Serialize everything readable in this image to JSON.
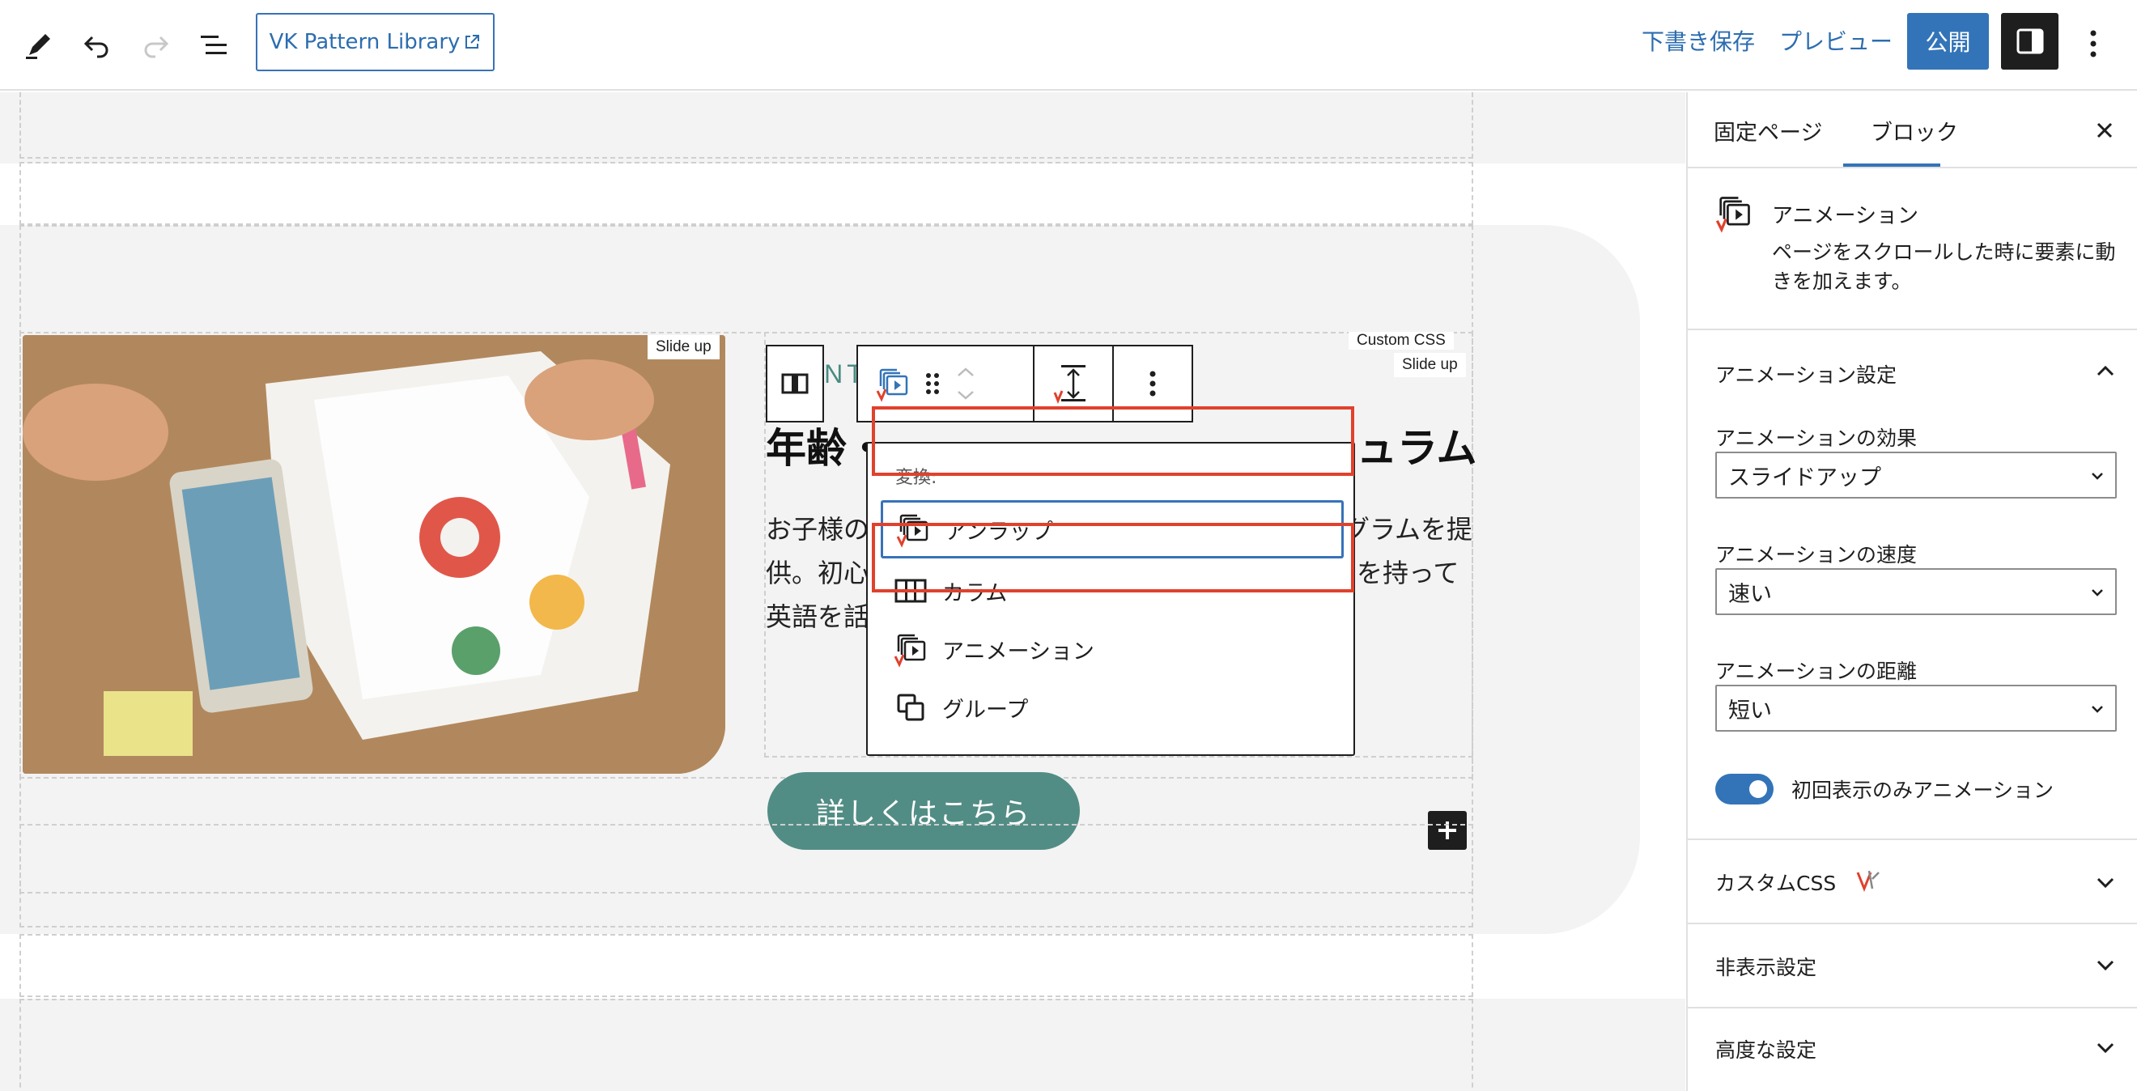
{
  "toolbar": {
    "pattern_library_label": "VK Pattern Library",
    "save_draft": "下書き保存",
    "preview": "プレビュー",
    "publish": "公開"
  },
  "canvas": {
    "badge_slide_up_image": "Slide up",
    "badge_custom_css": "Custom CSS",
    "badge_slide_up_text": "Slide up",
    "point_label": "POINT",
    "heading_left": "年齢・",
    "heading_right": "ュラム",
    "body_line1_left": "お子様の",
    "body_line1_right": "グラムを提",
    "body_line2_left": "供。初心",
    "body_line2_right": "を持って",
    "body_line3_left": "英語を話",
    "cta_label": "詳しくはこちら"
  },
  "transform_menu": {
    "label": "変換:",
    "items": [
      {
        "label": "アンラップ",
        "icon": "vk-animation-icon",
        "focused": true,
        "highlighted": true
      },
      {
        "label": "カラム",
        "icon": "columns-icon",
        "focused": false,
        "highlighted": false
      },
      {
        "label": "アニメーション",
        "icon": "vk-animation-icon",
        "focused": false,
        "highlighted": true
      },
      {
        "label": "グループ",
        "icon": "group-icon",
        "focused": false,
        "highlighted": false
      }
    ]
  },
  "sidebar": {
    "tabs": [
      "固定ページ",
      "ブロック"
    ],
    "active_tab": "ブロック",
    "block_title": "アニメーション",
    "block_desc": "ページをスクロールした時に要素に動きを加えます。",
    "animation_settings": {
      "title": "アニメーション設定",
      "effect_label": "アニメーションの効果",
      "effect_value": "スライドアップ",
      "speed_label": "アニメーションの速度",
      "speed_value": "速い",
      "distance_label": "アニメーションの距離",
      "distance_value": "短い",
      "toggle_label": "初回表示のみアニメーション",
      "toggle_on": true
    },
    "panels": [
      "カスタムCSS",
      "非表示設定",
      "高度な設定"
    ]
  },
  "colors": {
    "accent": "#3374b8",
    "highlight_red": "#e0412d",
    "teal": "#528d85"
  }
}
